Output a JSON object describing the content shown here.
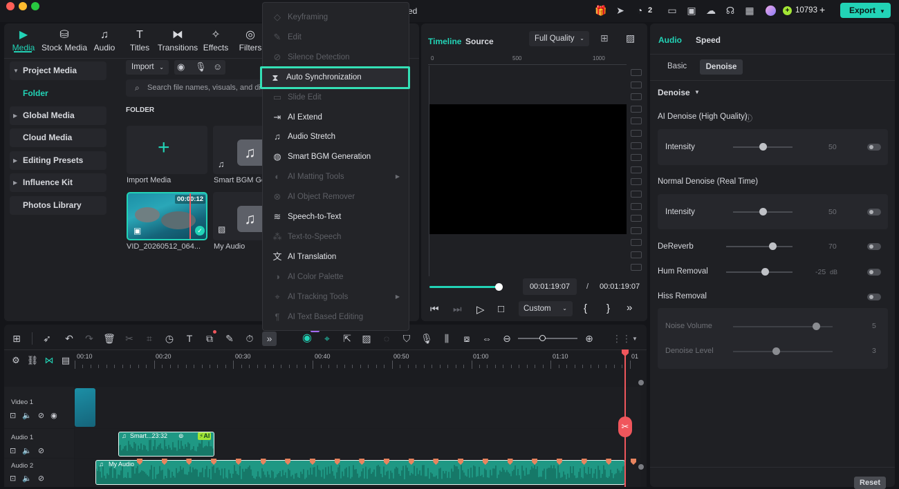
{
  "titlebar": {
    "title_suffix": "ed",
    "badge_count": "2",
    "credits": "10793",
    "export_label": "Export"
  },
  "toolbar": {
    "items": [
      {
        "label": "Media",
        "icon": "media-icon",
        "active": true
      },
      {
        "label": "Stock Media",
        "icon": "stock-media-icon"
      },
      {
        "label": "Audio",
        "icon": "audio-note-icon"
      },
      {
        "label": "Titles",
        "icon": "titles-icon"
      },
      {
        "label": "Transitions",
        "icon": "transitions-icon"
      },
      {
        "label": "Effects",
        "icon": "effects-icon"
      },
      {
        "label": "Filters",
        "icon": "filters-icon"
      }
    ]
  },
  "sidebar": {
    "project_media": "Project Media",
    "folder": "Folder",
    "global_media": "Global Media",
    "cloud_media": "Cloud Media",
    "editing_presets": "Editing Presets",
    "influence_kit": "Influence Kit",
    "photos_library": "Photos Library"
  },
  "media": {
    "import_label": "Import",
    "search_placeholder": "Search file names, visuals, and di",
    "folder_heading": "FOLDER",
    "cards": [
      {
        "label": "Import Media"
      },
      {
        "label": "Smart BGM Ge"
      },
      {
        "label": "VID_20260512_064...",
        "duration": "00:00:12"
      },
      {
        "label": "My Audio"
      }
    ]
  },
  "context_menu": {
    "items": [
      {
        "label": "Keyframing",
        "disabled": true,
        "icon": "keyframe-icon"
      },
      {
        "label": "Edit",
        "disabled": true,
        "icon": "edit-icon"
      },
      {
        "label": "Silence Detection",
        "disabled": true,
        "icon": "silence-icon"
      },
      {
        "label": "Auto Synchronization",
        "disabled": false,
        "highlight": true,
        "icon": "sync-icon"
      },
      {
        "label": "Slide Edit",
        "disabled": true,
        "icon": "slide-icon"
      },
      {
        "label": "AI Extend",
        "disabled": false,
        "icon": "ai-extend-icon"
      },
      {
        "label": "Audio Stretch",
        "disabled": false,
        "icon": "audio-stretch-icon"
      },
      {
        "label": "Smart BGM Generation",
        "disabled": false,
        "icon": "smart-bgm-icon"
      },
      {
        "label": "AI Matting Tools",
        "disabled": true,
        "submenu": true,
        "icon": "matting-icon"
      },
      {
        "label": "AI Object Remover",
        "disabled": true,
        "icon": "object-remover-icon"
      },
      {
        "label": "Speech-to-Text",
        "disabled": false,
        "icon": "speech-to-text-icon"
      },
      {
        "label": "Text-to-Speech",
        "disabled": true,
        "icon": "text-to-speech-icon"
      },
      {
        "label": "AI Translation",
        "disabled": false,
        "icon": "translation-icon"
      },
      {
        "label": "AI Color Palette",
        "disabled": true,
        "icon": "color-palette-icon"
      },
      {
        "label": "AI Tracking Tools",
        "disabled": true,
        "submenu": true,
        "icon": "tracking-icon"
      },
      {
        "label": "AI Text Based Editing",
        "disabled": true,
        "icon": "text-editing-icon"
      }
    ]
  },
  "preview": {
    "tab_timeline": "Timeline",
    "tab_source": "Source",
    "quality": "Full Quality",
    "ruler_500": "500",
    "ruler_1000": "1000",
    "current_time": "00:01:19:07",
    "separator": "/",
    "total_time": "00:01:19:07",
    "progress": 1.0,
    "zoom_label": "Custom"
  },
  "right_panel": {
    "tab_audio": "Audio",
    "tab_speed": "Speed",
    "sub_basic": "Basic",
    "sub_denoise": "Denoise",
    "section_denoise": "Denoise",
    "ai_denoise_title": "AI Denoise (High Quality)",
    "intensity_label": "Intensity",
    "ai_intensity_value": "50",
    "ai_intensity": 50,
    "normal_denoise_title": "Normal Denoise (Real Time)",
    "normal_intensity_value": "50",
    "normal_intensity": 50,
    "dereverb_label": "DeReverb",
    "dereverb_value": "70",
    "dereverb": 70,
    "hum_label": "Hum Removal",
    "hum_value": "-25",
    "hum_unit": "dB",
    "hum": -25,
    "hiss_label": "Hiss Removal",
    "noise_volume_label": "Noise Volume",
    "noise_volume_value": "5",
    "noise_volume": 5,
    "denoise_level_label": "Denoise Level",
    "denoise_level_value": "3",
    "denoise_level": 3,
    "reset_label": "Reset"
  },
  "timeline": {
    "ruler": [
      "00:10",
      "00:20",
      "00:30",
      "00:40",
      "00:50",
      "01:00",
      "01:10",
      "01"
    ],
    "tracks": {
      "video1": "Video 1",
      "audio1": "Audio 1",
      "audio2": "Audio 2"
    },
    "clip_smart": "Smart...23:32",
    "clip_ai_badge": "AI",
    "clip_my_audio": "My Audio",
    "colors": {
      "accent": "#22d3b6",
      "playhead": "#f0565c",
      "clip": "#1fa58e",
      "highlight": "#34e0b6"
    }
  }
}
